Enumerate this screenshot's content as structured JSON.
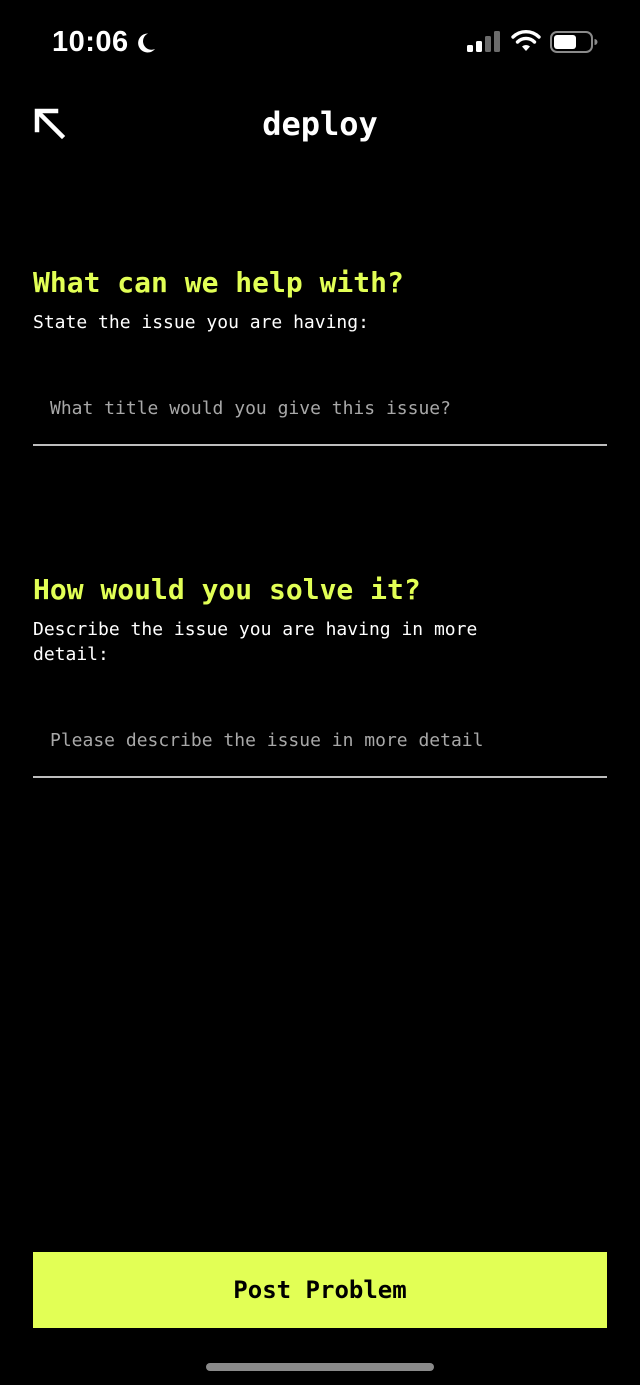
{
  "status_bar": {
    "time": "10:06",
    "icons": [
      "moon-icon",
      "cellular-signal-icon",
      "wifi-icon",
      "battery-icon"
    ]
  },
  "header": {
    "title": "deploy",
    "back_icon": "arrow-up-left-icon"
  },
  "section_title": {
    "heading": "What can we help with?",
    "subtitle": "State the issue you are having:",
    "input_value": "",
    "input_placeholder": "What title would you give this issue?"
  },
  "section_description": {
    "heading": "How would you solve it?",
    "subtitle": "Describe the issue you are having in more\ndetail:",
    "input_value": "",
    "input_placeholder": "Please describe the issue in more detail"
  },
  "actions": {
    "submit_label": "Post Problem"
  },
  "colors": {
    "background": "#000000",
    "accent": "#e2ff55",
    "text": "#ffffff",
    "placeholder": "#a8a8a8",
    "divider": "#bdbdbd"
  }
}
